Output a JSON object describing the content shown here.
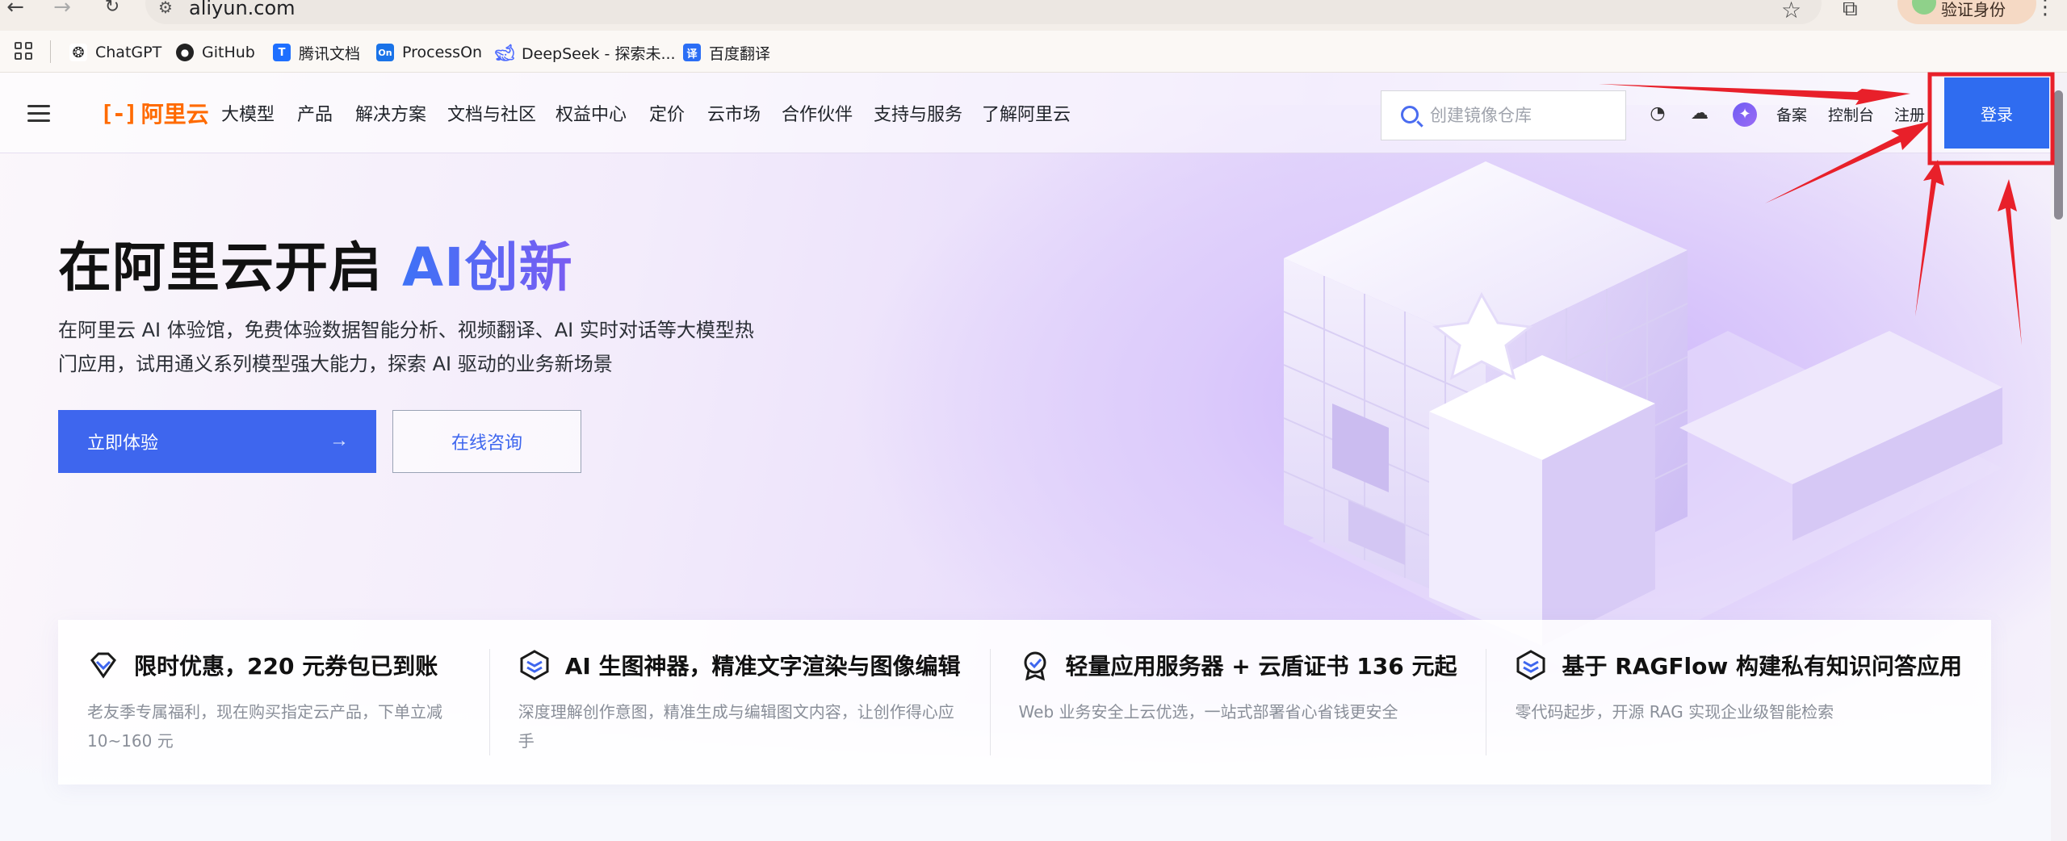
{
  "browser": {
    "url": "aliyun.com",
    "profile_label": "验证身份",
    "bookmarks": [
      {
        "label": "ChatGPT",
        "icon": "chatgpt-icon"
      },
      {
        "label": "GitHub",
        "icon": "github-icon"
      },
      {
        "label": "腾讯文档",
        "icon": "tencent-docs-icon"
      },
      {
        "label": "ProcessOn",
        "icon": "processon-icon"
      },
      {
        "label": "DeepSeek - 探索未...",
        "icon": "deepseek-icon"
      },
      {
        "label": "百度翻译",
        "icon": "baidu-translate-icon"
      }
    ]
  },
  "nav": {
    "logo_text": "阿里云",
    "items": [
      "大模型",
      "产品",
      "解决方案",
      "文档与社区",
      "权益中心",
      "定价",
      "云市场",
      "合作伙伴",
      "支持与服务",
      "了解阿里云"
    ],
    "search_placeholder": "创建镜像仓库",
    "links": {
      "beian": "备案",
      "console": "控制台",
      "register": "注册"
    },
    "login_label": "登录"
  },
  "hero": {
    "title_prefix": "在阿里云开启 ",
    "title_accent": "AI创新",
    "description": "在阿里云 AI 体验馆，免费体验数据智能分析、视频翻译、AI 实时对话等大模型热门应用，试用通义系列模型强大能力，探索 AI 驱动的业务新场景",
    "primary_button": "立即体验",
    "secondary_button": "在线咨询"
  },
  "cards": [
    {
      "title": "限时优惠，220 元券包已到账",
      "desc": "老友季专属福利，现在购买指定云产品，下单立减 10~160 元"
    },
    {
      "title": "AI 生图神器，精准文字渲染与图像编辑",
      "desc": "深度理解创作意图，精准生成与编辑图文内容，让创作得心应手"
    },
    {
      "title": "轻量应用服务器 + 云盾证书 136 元起",
      "desc": "Web 业务安全上云优选，一站式部署省心省钱更安全"
    },
    {
      "title": "基于 RAGFlow 构建私有知识问答应用",
      "desc": "零代码起步，开源 RAG 实现企业级智能检索"
    }
  ],
  "colors": {
    "brand": "#ff6a00",
    "primary": "#3e66ee",
    "annotation": "#e8202a"
  }
}
